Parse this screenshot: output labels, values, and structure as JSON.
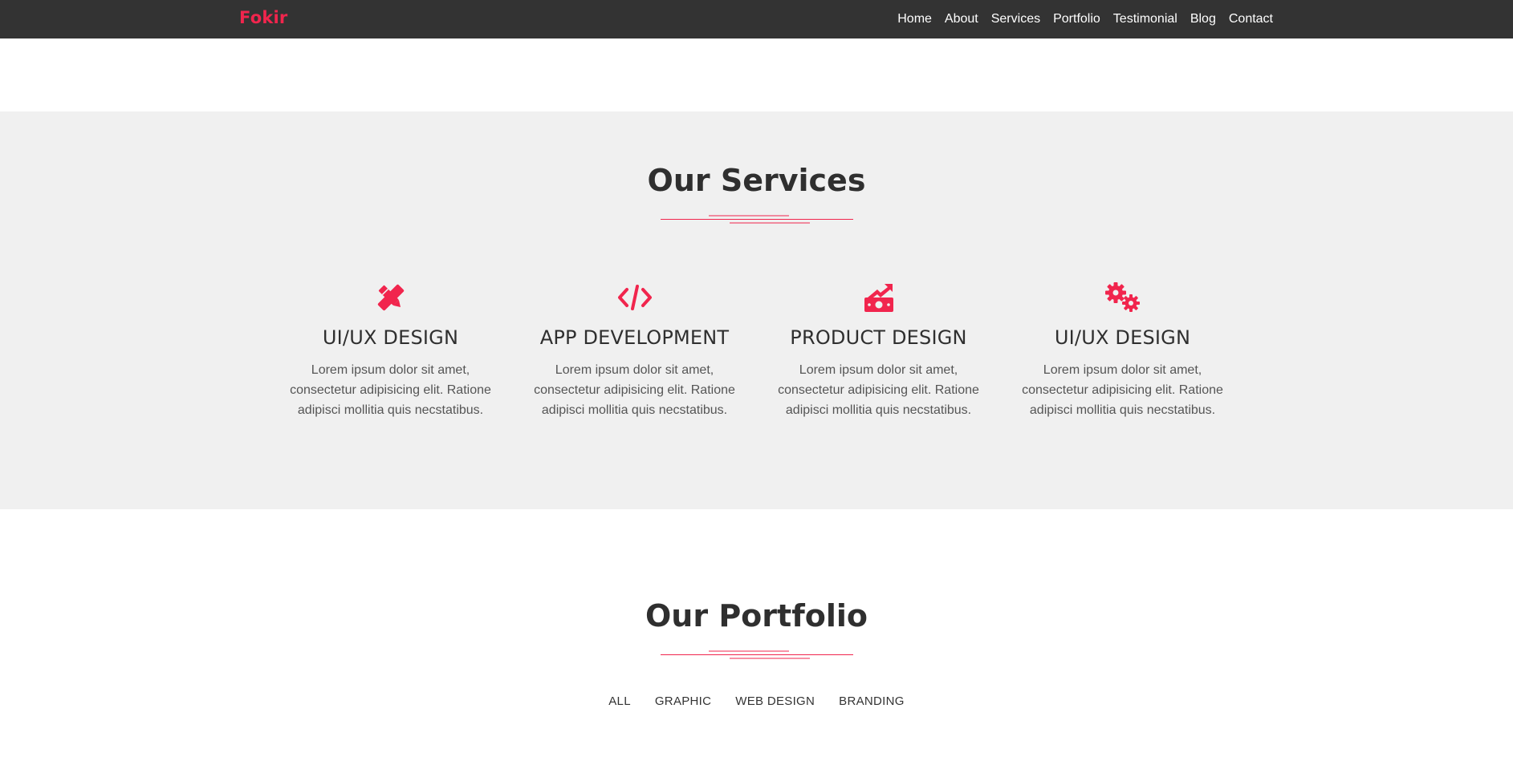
{
  "colors": {
    "accent": "#f1254d",
    "nav_bg": "#333333",
    "section_bg": "#f0f0f0"
  },
  "header": {
    "brand": "Fokir",
    "nav": [
      "Home",
      "About",
      "Services",
      "Portfolio",
      "Testimonial",
      "Blog",
      "Contact"
    ]
  },
  "services": {
    "title": "Our Services",
    "items": [
      {
        "icon": "pencil-ruler-icon",
        "title": "UI/UX DESIGN",
        "text": "Lorem ipsum dolor sit amet, consectetur adipisicing elit. Ratione adipisci mollitia quis necstatibus."
      },
      {
        "icon": "code-icon",
        "title": "APP DEVELOPMENT",
        "text": "Lorem ipsum dolor sit amet, consectetur adipisicing elit. Ratione adipisci mollitia quis necstatibus."
      },
      {
        "icon": "money-chart-icon",
        "title": "PRODUCT DESIGN",
        "text": "Lorem ipsum dolor sit amet, consectetur adipisicing elit. Ratione adipisci mollitia quis necstatibus."
      },
      {
        "icon": "gears-icon",
        "title": "UI/UX DESIGN",
        "text": "Lorem ipsum dolor sit amet, consectetur adipisicing elit. Ratione adipisci mollitia quis necstatibus."
      }
    ]
  },
  "portfolio": {
    "title": "Our Portfolio",
    "filters": [
      "ALL",
      "GRAPHIC",
      "WEB DESIGN",
      "BRANDING"
    ]
  }
}
